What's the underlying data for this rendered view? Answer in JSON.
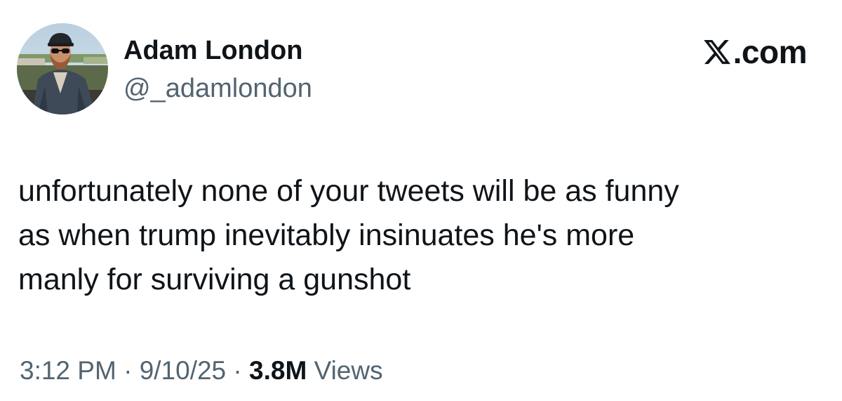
{
  "author": {
    "display_name": "Adam London",
    "handle": "@_adamlondon",
    "avatar_icon": "profile-photo"
  },
  "brand": {
    "logo_icon": "x-logo-icon",
    "domain": ".com"
  },
  "tweet": {
    "text_lines": [
      "unfortunately none of your tweets will be as funny",
      "as when trump inevitably insinuates he's more",
      "manly for surviving a gunshot"
    ]
  },
  "meta": {
    "time": "3:12 PM",
    "separator": "·",
    "date": "9/10/25",
    "views_count": "3.8M",
    "views_label": "Views"
  },
  "colors": {
    "text_primary": "#0f1419",
    "text_secondary": "#536471",
    "background": "#ffffff"
  }
}
